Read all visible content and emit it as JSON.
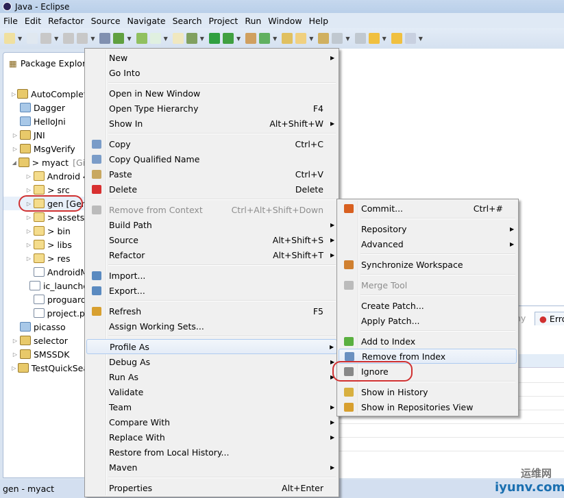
{
  "window": {
    "title": "Java - Eclipse"
  },
  "menubar": [
    "File",
    "Edit",
    "Refactor",
    "Source",
    "Navigate",
    "Search",
    "Project",
    "Run",
    "Window",
    "Help"
  ],
  "package_explorer": {
    "title": "Package Explore",
    "items": [
      {
        "label": "AutoComplete",
        "twisty": "▷",
        "icon": "proj",
        "indent": 0
      },
      {
        "label": "Dagger",
        "twisty": "",
        "icon": "fold",
        "indent": 0
      },
      {
        "label": "HelloJni",
        "twisty": "",
        "icon": "fold",
        "indent": 0
      },
      {
        "label": "JNI",
        "twisty": "▷",
        "icon": "proj",
        "indent": 0
      },
      {
        "label": "MsgVerify",
        "twisty": "▷",
        "icon": "proj",
        "indent": 0
      },
      {
        "label": "> myact",
        "suffix": "[Git",
        "twisty": "◢",
        "icon": "proj",
        "indent": 0
      },
      {
        "label": "Android 4",
        "twisty": "▷",
        "icon": "pkg",
        "indent": 1
      },
      {
        "label": "> src",
        "twisty": "▷",
        "icon": "pkg",
        "indent": 1
      },
      {
        "label": "gen [Gen",
        "twisty": "▷",
        "icon": "pkg",
        "indent": 1
      },
      {
        "label": "> assets",
        "twisty": "▷",
        "icon": "pkg",
        "indent": 1
      },
      {
        "label": "> bin",
        "twisty": "▷",
        "icon": "pkg",
        "indent": 1
      },
      {
        "label": "> libs",
        "twisty": "▷",
        "icon": "pkg",
        "indent": 1
      },
      {
        "label": "> res",
        "twisty": "▷",
        "icon": "pkg",
        "indent": 1
      },
      {
        "label": "AndroidM",
        "twisty": "",
        "icon": "file",
        "indent": 1
      },
      {
        "label": "ic_launche",
        "twisty": "",
        "icon": "file",
        "indent": 1
      },
      {
        "label": "proguard",
        "twisty": "",
        "icon": "file",
        "indent": 1
      },
      {
        "label": "project.pr",
        "twisty": "",
        "icon": "file",
        "indent": 1
      },
      {
        "label": "picasso",
        "twisty": "",
        "icon": "fold",
        "indent": 0
      },
      {
        "label": "selector",
        "twisty": "▷",
        "icon": "proj",
        "indent": 0
      },
      {
        "label": "SMSSDK",
        "twisty": "▷",
        "icon": "proj",
        "indent": 0
      },
      {
        "label": "TestQuickSea",
        "twisty": "▷",
        "icon": "proj",
        "indent": 0
      }
    ]
  },
  "context_menu": [
    {
      "label": "New",
      "arrow": true
    },
    {
      "label": "Go Into"
    },
    {
      "sep": true
    },
    {
      "label": "Open in New Window"
    },
    {
      "label": "Open Type Hierarchy",
      "shortcut": "F4"
    },
    {
      "label": "Show In",
      "shortcut": "Alt+Shift+W",
      "arrow": true
    },
    {
      "sep": true
    },
    {
      "label": "Copy",
      "shortcut": "Ctrl+C",
      "icon": "copy"
    },
    {
      "label": "Copy Qualified Name",
      "icon": "copy"
    },
    {
      "label": "Paste",
      "shortcut": "Ctrl+V",
      "icon": "paste"
    },
    {
      "label": "Delete",
      "shortcut": "Delete",
      "icon": "delete"
    },
    {
      "sep": true
    },
    {
      "label": "Remove from Context",
      "shortcut": "Ctrl+Alt+Shift+Down",
      "disabled": true,
      "icon": "context"
    },
    {
      "label": "Build Path",
      "arrow": true
    },
    {
      "label": "Source",
      "shortcut": "Alt+Shift+S",
      "arrow": true
    },
    {
      "label": "Refactor",
      "shortcut": "Alt+Shift+T",
      "arrow": true
    },
    {
      "sep": true
    },
    {
      "label": "Import...",
      "icon": "import"
    },
    {
      "label": "Export...",
      "icon": "export"
    },
    {
      "sep": true
    },
    {
      "label": "Refresh",
      "shortcut": "F5",
      "icon": "refresh"
    },
    {
      "label": "Assign Working Sets..."
    },
    {
      "sep": true
    },
    {
      "label": "Profile As",
      "arrow": true,
      "highlighted": true
    },
    {
      "label": "Debug As",
      "arrow": true
    },
    {
      "label": "Run As",
      "arrow": true
    },
    {
      "label": "Validate"
    },
    {
      "label": "Team",
      "arrow": true
    },
    {
      "label": "Compare With",
      "arrow": true
    },
    {
      "label": "Replace With",
      "arrow": true
    },
    {
      "label": "Restore from Local History..."
    },
    {
      "label": "Maven",
      "arrow": true
    },
    {
      "sep": true
    },
    {
      "label": "Properties",
      "shortcut": "Alt+Enter"
    }
  ],
  "team_submenu": [
    {
      "label": "Commit...",
      "shortcut": "Ctrl+#",
      "icon": "commit"
    },
    {
      "sep": true
    },
    {
      "label": "Repository",
      "arrow": true
    },
    {
      "label": "Advanced",
      "arrow": true
    },
    {
      "sep": true
    },
    {
      "label": "Synchronize Workspace",
      "icon": "sync"
    },
    {
      "sep": true
    },
    {
      "label": "Merge Tool",
      "disabled": true,
      "icon": "merge"
    },
    {
      "sep": true
    },
    {
      "label": "Create Patch..."
    },
    {
      "label": "Apply Patch..."
    },
    {
      "sep": true
    },
    {
      "label": "Add to Index",
      "icon": "add"
    },
    {
      "label": "Remove from Index",
      "icon": "remove",
      "highlighted": true
    },
    {
      "label": "Ignore",
      "icon": "ignore"
    },
    {
      "sep": true
    },
    {
      "label": "Show in History",
      "icon": "history"
    },
    {
      "label": "Show in Repositories View",
      "icon": "git"
    }
  ],
  "lower_panel": {
    "tab_partial": "hy",
    "tab": "Erro"
  },
  "status": "gen - myact",
  "watermark": {
    "cn": "运维网",
    "en": "iyunv.com"
  },
  "icon_colors": {
    "copy": "#7a9cc8",
    "paste": "#c8a860",
    "delete": "#d83030",
    "context": "#bbbbbb",
    "import": "#5a8ac0",
    "export": "#5a8ac0",
    "refresh": "#d8a030",
    "commit": "#d86020",
    "sync": "#d08030",
    "merge": "#bbbbbb",
    "add": "#5ab040",
    "remove": "#6a90c0",
    "ignore": "#888888",
    "history": "#d8b040",
    "git": "#d8a030"
  }
}
